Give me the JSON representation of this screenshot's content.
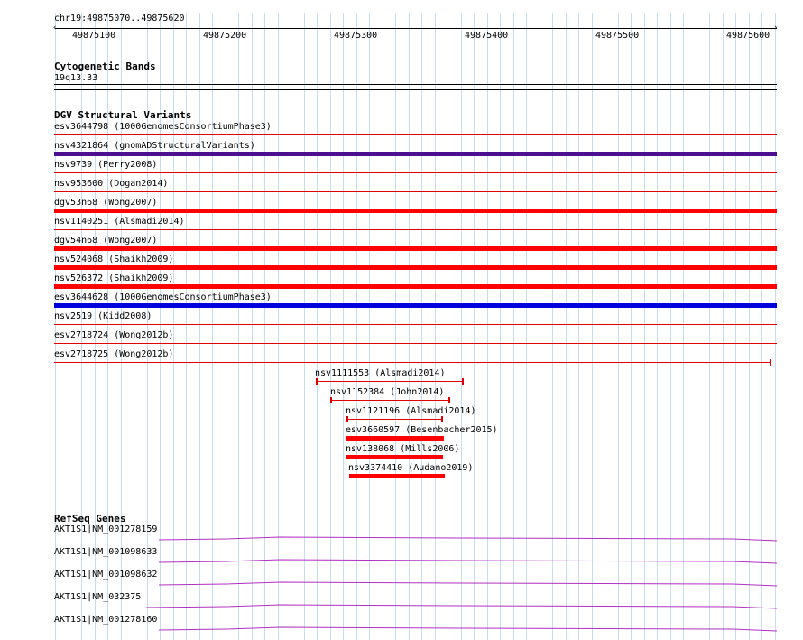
{
  "ruler": {
    "label": "chr19:49875070..49875620",
    "ticks": [
      "49875100",
      "49875200",
      "49875300",
      "49875400",
      "49875500",
      "49875600"
    ]
  },
  "cytoband": {
    "title": "Cytogenetic Bands",
    "band": "19q13.33"
  },
  "dgv": {
    "title": "DGV Structural Variants",
    "features": [
      {
        "label": "esv3644798 (1000GenomesConsortiumPhase3)",
        "color": "#e00000"
      },
      {
        "label": "nsv4321864 (gnomADStructuralVariants)",
        "color": "#4b0f8f"
      },
      {
        "label": "nsv9739 (Perry2008)",
        "color": "#e00000"
      },
      {
        "label": "nsv953600 (Dogan2014)",
        "color": "#e00000"
      },
      {
        "label": "dgv53n68 (Wong2007)",
        "color": "#ff0000"
      },
      {
        "label": "nsv1140251 (Alsmadi2014)",
        "color": "#e00000"
      },
      {
        "label": "dgv54n68 (Wong2007)",
        "color": "#ff0000"
      },
      {
        "label": "nsv524068 (Shaikh2009)",
        "color": "#ff0000"
      },
      {
        "label": "nsv526372 (Shaikh2009)",
        "color": "#ff0000"
      },
      {
        "label": "esv3644628 (1000GenomesConsortiumPhase3)",
        "color": "#0000dd"
      },
      {
        "label": "nsv2519 (Kidd2008)",
        "color": "#e00000"
      },
      {
        "label": "esv2718724 (Wong2012b)",
        "color": "#e00000"
      },
      {
        "label": "esv2718725 (Wong2012b)",
        "color": "#e00000"
      },
      {
        "label": "nsv1111553 (Alsmadi2014)",
        "color": "#e00000"
      },
      {
        "label": "nsv1152384 (John2014)",
        "color": "#e00000"
      },
      {
        "label": "nsv1121196 (Alsmadi2014)",
        "color": "#e00000"
      },
      {
        "label": "esv3660597 (Besenbacher2015)",
        "color": "#ff0000"
      },
      {
        "label": "nsv138068 (Mills2006)",
        "color": "#ff0000"
      },
      {
        "label": "nsv3374410 (Audano2019)",
        "color": "#ff0000"
      }
    ]
  },
  "refseq": {
    "title": "RefSeq Genes",
    "color": "#b030c0",
    "genes": [
      {
        "label": "AKT1S1|NM_001278159"
      },
      {
        "label": "AKT1S1|NM_001098633"
      },
      {
        "label": "AKT1S1|NM_001098632"
      },
      {
        "label": "AKT1S1|NM_032375"
      },
      {
        "label": "AKT1S1|NM_001278160"
      }
    ]
  }
}
